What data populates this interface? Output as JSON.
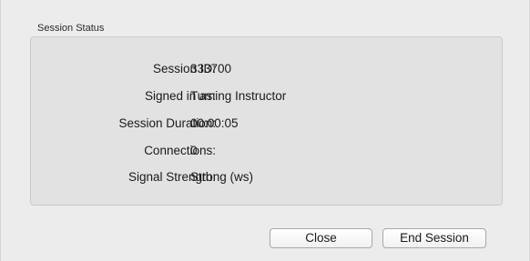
{
  "group": {
    "title": "Session Status"
  },
  "fields": [
    {
      "label": "Session ID:",
      "value": "333700"
    },
    {
      "label": "Signed in as:",
      "value": "Turning Instructor"
    },
    {
      "label": "Session Duration:",
      "value": "00:00:05"
    },
    {
      "label": "Connections:",
      "value": "0"
    },
    {
      "label": "Signal Strength:",
      "value": "Strong (ws)"
    }
  ],
  "buttons": {
    "close_label": "Close",
    "end_session_label": "End Session"
  }
}
